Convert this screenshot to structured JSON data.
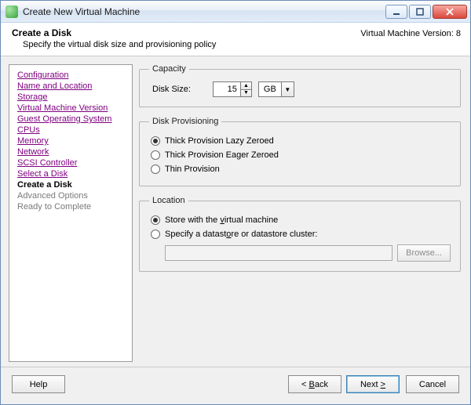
{
  "window": {
    "title": "Create New Virtual Machine"
  },
  "header": {
    "title": "Create a Disk",
    "subtitle": "Specify the virtual disk size and provisioning policy",
    "version_label": "Virtual Machine Version: 8"
  },
  "sidebar": {
    "items": [
      {
        "label": "Configuration",
        "state": "link"
      },
      {
        "label": "Name and Location",
        "state": "link"
      },
      {
        "label": "Storage",
        "state": "link"
      },
      {
        "label": "Virtual Machine Version",
        "state": "link"
      },
      {
        "label": "Guest Operating System",
        "state": "link"
      },
      {
        "label": "CPUs",
        "state": "link"
      },
      {
        "label": "Memory",
        "state": "link"
      },
      {
        "label": "Network",
        "state": "link"
      },
      {
        "label": "SCSI Controller",
        "state": "link"
      },
      {
        "label": "Select a Disk",
        "state": "link"
      },
      {
        "label": "Create a Disk",
        "state": "current"
      },
      {
        "label": "Advanced Options",
        "state": "disabled"
      },
      {
        "label": "Ready to Complete",
        "state": "disabled"
      }
    ]
  },
  "capacity": {
    "legend": "Capacity",
    "disk_size_label": "Disk Size:",
    "disk_size_value": "15",
    "unit_value": "GB"
  },
  "provisioning": {
    "legend": "Disk Provisioning",
    "options": [
      {
        "label": "Thick Provision Lazy Zeroed",
        "checked": true
      },
      {
        "label": "Thick Provision Eager Zeroed",
        "checked": false
      },
      {
        "label": "Thin Provision",
        "checked": false
      }
    ]
  },
  "location": {
    "legend": "Location",
    "options": [
      {
        "label_pre": "Store with the ",
        "label_u": "v",
        "label_post": "irtual machine",
        "checked": true
      },
      {
        "label_pre": "Specify a datast",
        "label_u": "o",
        "label_post": "re or datastore cluster:",
        "checked": false
      }
    ],
    "path_value": "",
    "browse_label": "Browse..."
  },
  "footer": {
    "help_label": "Help",
    "back_pre": "< ",
    "back_u": "B",
    "back_post": "ack",
    "next_pre": "Next ",
    "next_u": ">",
    "next_post": "",
    "next_label_pre": "Next ",
    "next_label_u": "",
    "next_label_post": "",
    "cancel_label": "Cancel"
  }
}
